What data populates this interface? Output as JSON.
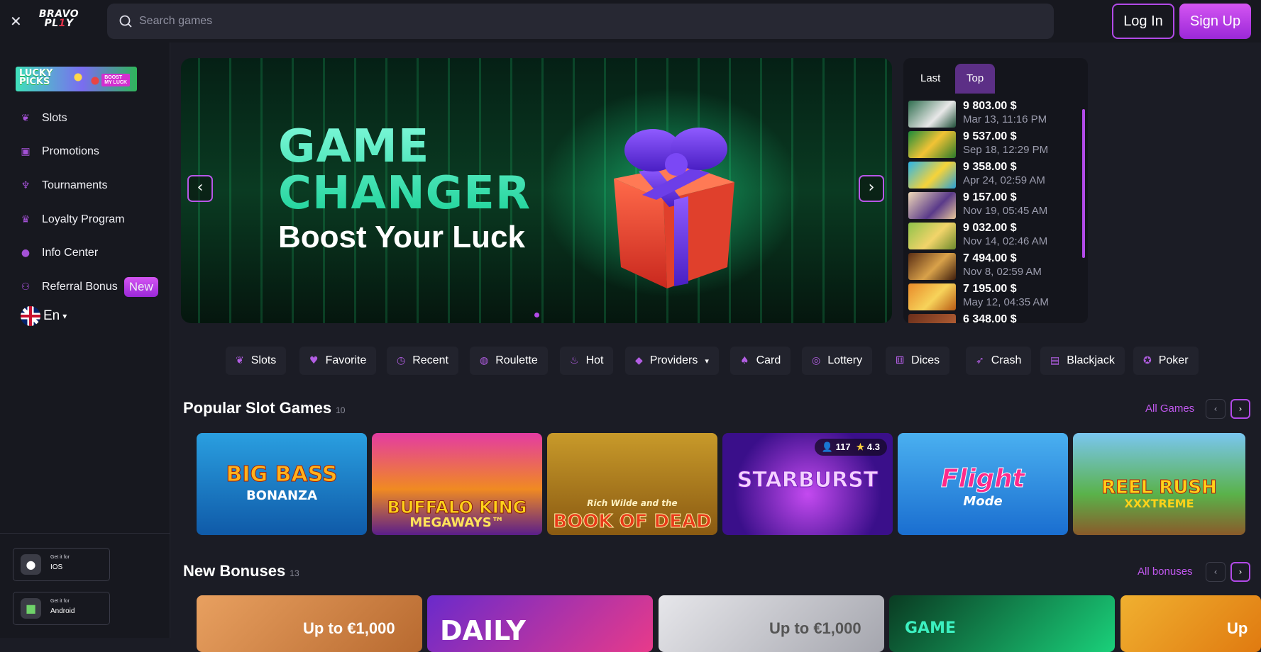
{
  "header": {
    "logo_line1": "BRAVO",
    "logo_line2a": "PL",
    "logo_line2b": "1",
    "logo_line2c": "Y",
    "search_placeholder": "Search games",
    "login_label": "Log In",
    "signup_label": "Sign Up"
  },
  "sidebar": {
    "promo_line1": "LUCKY",
    "promo_line2": "PICKS",
    "promo_badge_line1": "BOOST",
    "promo_badge_line2": "MY LUCK",
    "items": [
      {
        "label": "Slots",
        "icon": "cherries-icon"
      },
      {
        "label": "Promotions",
        "icon": "gift-icon"
      },
      {
        "label": "Tournaments",
        "icon": "trophy-icon"
      },
      {
        "label": "Loyalty Program",
        "icon": "crown-icon"
      },
      {
        "label": "Info Center",
        "icon": "info-icon"
      },
      {
        "label": "Referral Bonus",
        "icon": "people-icon"
      }
    ],
    "new_badge": "New",
    "language": "En",
    "ios_small": "Get it for",
    "ios_big": "IOS",
    "android_small": "Get it for",
    "android_big": "Android"
  },
  "hero": {
    "line1": "GAME",
    "line2": "CHANGER",
    "subtitle": "Boost Your Luck",
    "slide_count": 1,
    "active_slide": 1
  },
  "winners": {
    "tabs": [
      "Last",
      "Top"
    ],
    "active_tab": "Top",
    "rows": [
      {
        "amount": "9 803.00 $",
        "date": "Mar 13, 11:16 PM"
      },
      {
        "amount": "9 537.00 $",
        "date": "Sep 18, 12:29 PM"
      },
      {
        "amount": "9 358.00 $",
        "date": "Apr 24, 02:59 AM"
      },
      {
        "amount": "9 157.00 $",
        "date": "Nov 19, 05:45 AM"
      },
      {
        "amount": "9 032.00 $",
        "date": "Nov 14, 02:46 AM"
      },
      {
        "amount": "7 494.00 $",
        "date": "Nov 8, 02:59 AM"
      },
      {
        "amount": "7 195.00 $",
        "date": "May 12, 04:35 AM"
      },
      {
        "amount": "6 348.00 $",
        "date": ""
      }
    ]
  },
  "categories": [
    {
      "label": "Slots",
      "icon": "cherries-icon"
    },
    {
      "label": "Favorite",
      "icon": "heart-icon"
    },
    {
      "label": "Recent",
      "icon": "history-icon"
    },
    {
      "label": "Roulette",
      "icon": "roulette-icon"
    },
    {
      "label": "Hot",
      "icon": "flame-icon"
    },
    {
      "label": "Providers",
      "icon": "diamond-icon"
    },
    {
      "label": "Card",
      "icon": "cards-icon"
    },
    {
      "label": "Lottery",
      "icon": "lottery-icon"
    },
    {
      "label": "Dices",
      "icon": "dice-icon"
    },
    {
      "label": "Crash",
      "icon": "rocket-icon"
    },
    {
      "label": "Blackjack",
      "icon": "blackjack-icon"
    },
    {
      "label": "Poker",
      "icon": "chip-icon"
    }
  ],
  "popular": {
    "title": "Popular Slot Games",
    "count": "10",
    "link": "All Games",
    "games": [
      {
        "name": "BIG BASS",
        "sub": "BONANZA"
      },
      {
        "name": "BUFFALO KING",
        "sub": "MEGAWAYS™"
      },
      {
        "name": "BOOK OF DEAD",
        "sub": "Rich Wilde and the"
      },
      {
        "name": "STARBURST",
        "sub": ""
      },
      {
        "name": "Flight",
        "sub": "Mode"
      },
      {
        "name": "REEL RUSH",
        "sub": "XXXTREME"
      }
    ],
    "starburst_players": "117",
    "starburst_rating": "4.3"
  },
  "bonuses": {
    "title": "New Bonuses",
    "count": "13",
    "link": "All bonuses",
    "cards": [
      {
        "text": "Up to €1,000"
      },
      {
        "text": "DAILY"
      },
      {
        "text": "Up to €1,000"
      },
      {
        "text": "GAME"
      },
      {
        "text": "Up"
      }
    ]
  },
  "colors": {
    "accent": "#b24ae8",
    "background": "#1b1c25",
    "sidebar": "#17181f"
  }
}
